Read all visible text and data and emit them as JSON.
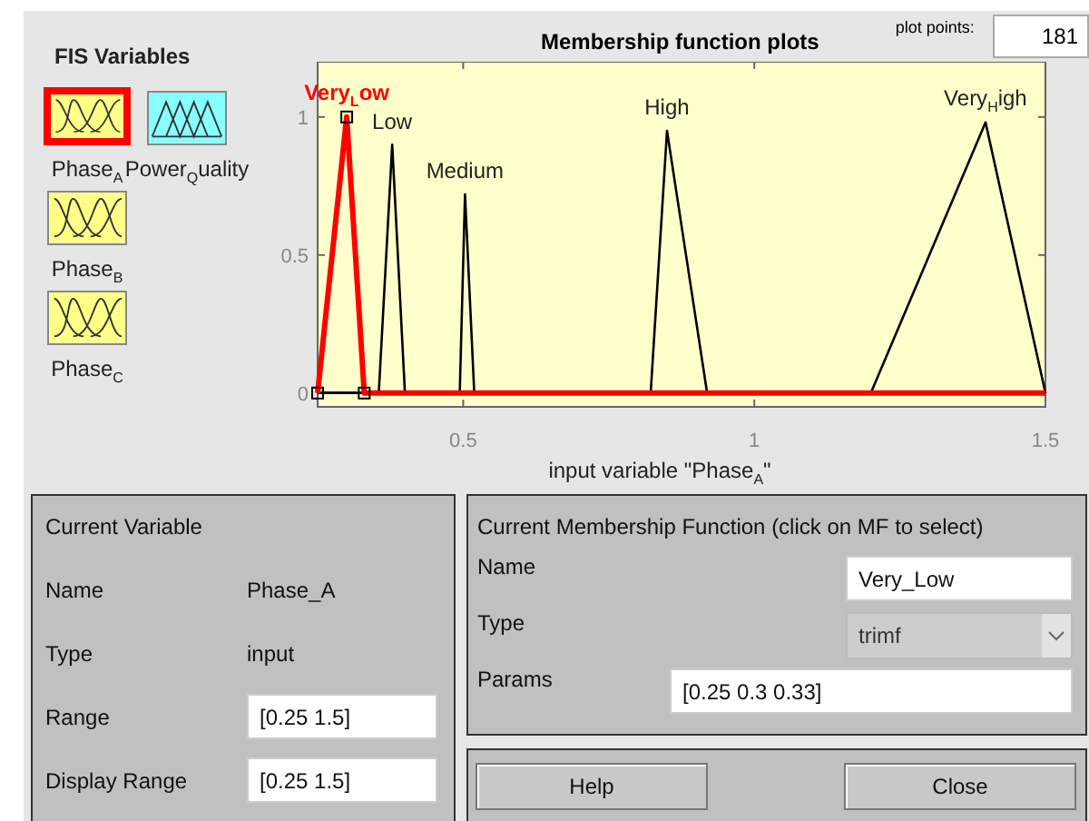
{
  "fis_variables": {
    "title": "FIS Variables",
    "items": [
      {
        "label": "Phase$_{A}$",
        "kind": "input",
        "selected": true
      },
      {
        "label": "Power$_{Q}$uality",
        "kind": "output",
        "selected": false
      },
      {
        "label": "Phase$_{B}$",
        "kind": "input",
        "selected": false
      },
      {
        "label": "Phase$_{C}$",
        "kind": "input",
        "selected": false
      }
    ]
  },
  "plot": {
    "title": "Membership function plots",
    "plot_points_label": "plot points:",
    "plot_points": "181",
    "chart_data": {
      "type": "line",
      "xlabel": "input variable \"Phase$_{A}$\"",
      "x": [
        0.25,
        0.3,
        0.33,
        0.355,
        0.378,
        0.4,
        0.494,
        0.503,
        0.519,
        0.822,
        0.85,
        0.919,
        1.2,
        1.397,
        1.5
      ],
      "xlim": [
        0.25,
        1.5
      ],
      "ylim": [
        -0.05,
        1.2
      ],
      "xticks": [
        0.5,
        1,
        1.5
      ],
      "yticks": [
        0,
        0.5,
        1
      ],
      "series": [
        {
          "name": "Very$_{L}$ow",
          "color": "#ff0000",
          "values": [
            0,
            1,
            0,
            0,
            0,
            0,
            0,
            0,
            0,
            0,
            0,
            0,
            0,
            0,
            0
          ]
        },
        {
          "name": "Low",
          "color": "#000000",
          "values": [
            0,
            0,
            0,
            0,
            0.9,
            0,
            0,
            0,
            0,
            0,
            0,
            0,
            0,
            0,
            0
          ]
        },
        {
          "name": "Medium",
          "color": "#000000",
          "values": [
            0,
            0,
            0,
            0,
            0,
            0,
            0,
            0.72,
            0,
            0,
            0,
            0,
            0,
            0,
            0
          ]
        },
        {
          "name": "High",
          "color": "#000000",
          "values": [
            0,
            0,
            0,
            0,
            0,
            0,
            0,
            0,
            0,
            0,
            0.95,
            0,
            0,
            0,
            0
          ]
        },
        {
          "name": "Very$_{H}$igh",
          "color": "#000000",
          "values": [
            0,
            0,
            0,
            0,
            0,
            0,
            0,
            0,
            0,
            0,
            0,
            0,
            0,
            0.98,
            0
          ]
        }
      ]
    }
  },
  "current_variable": {
    "title": "Current Variable",
    "fields": [
      {
        "label": "Name",
        "value": "Phase_A",
        "kind": "text"
      },
      {
        "label": "Type",
        "value": "input",
        "kind": "text"
      },
      {
        "label": "Range",
        "value": "[0.25 1.5]",
        "kind": "input"
      },
      {
        "label": "Display Range",
        "value": "[0.25 1.5]",
        "kind": "input"
      }
    ]
  },
  "current_mf": {
    "title": "Current Membership Function (click on MF to select)",
    "fields": [
      {
        "label": "Name",
        "value": "Very_Low",
        "kind": "input"
      },
      {
        "label": "Type",
        "value": "trimf",
        "kind": "select"
      },
      {
        "label": "Params",
        "value": "[0.25 0.3 0.33]",
        "kind": "wide_input"
      }
    ]
  },
  "buttons": [
    "Help",
    "Close"
  ]
}
